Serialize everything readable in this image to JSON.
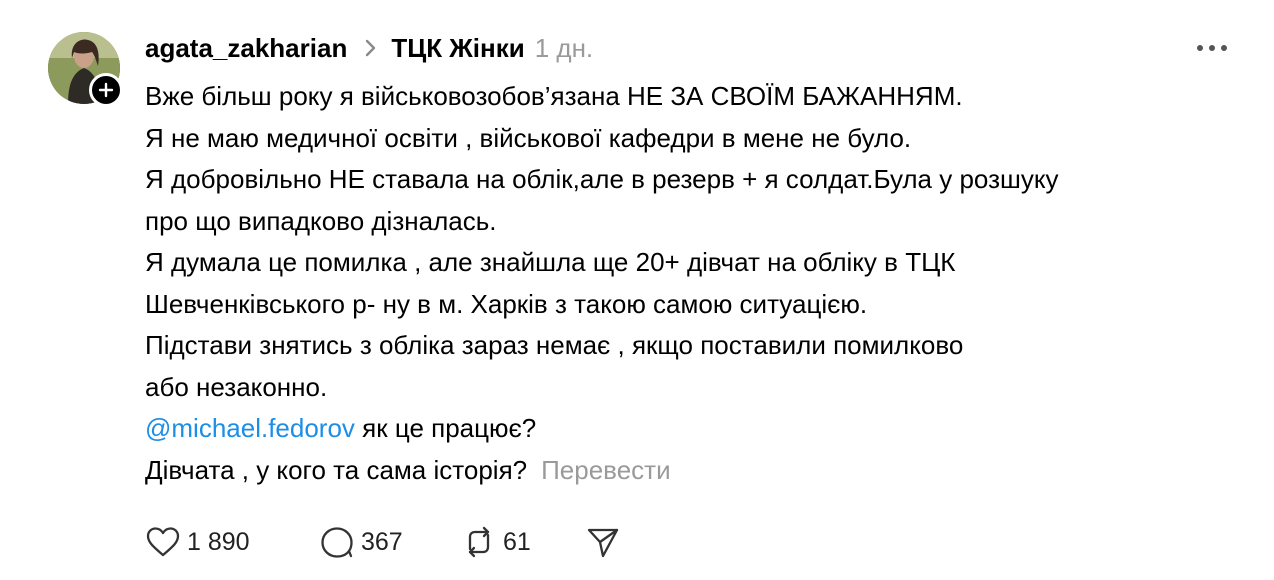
{
  "post": {
    "author": "agata_zakharian",
    "community": "ТЦК Жінки",
    "time": "1 дн.",
    "lines": [
      "Вже більш року я військовозобов’язана НЕ ЗА СВОЇМ БАЖАННЯМ.",
      "Я не маю медичної освіти , військової кафедри в мене не було.",
      "Я добровільно НЕ ставала на облік,але в резерв + я солдат.Була у розшуку",
      "про що випадково дізналась.",
      "Я думала це помилка , але знайшла ще 20+ дівчат на обліку в ТЦК",
      "Шевченківського р- ну в м. Харків з такою самою ситуацією.",
      "Підстави знятись з обліка зараз немає , якщо поставили помилково",
      "або незаконно."
    ],
    "mention": "@michael.fedorov",
    "mention_suffix": " як це працює?",
    "last_line": "Дівчата , у кого та сама історія?",
    "translate_label": "Перевести"
  },
  "actions": {
    "likes": "1 890",
    "replies": "367",
    "reposts": "61"
  },
  "colors": {
    "mention": "#1d8ee6",
    "muted": "#9a9a9a",
    "text": "#000000"
  },
  "icons": [
    "follow-plus-icon",
    "chevron-right-icon",
    "more-icon",
    "heart-icon",
    "comment-icon",
    "repost-icon",
    "share-icon"
  ]
}
